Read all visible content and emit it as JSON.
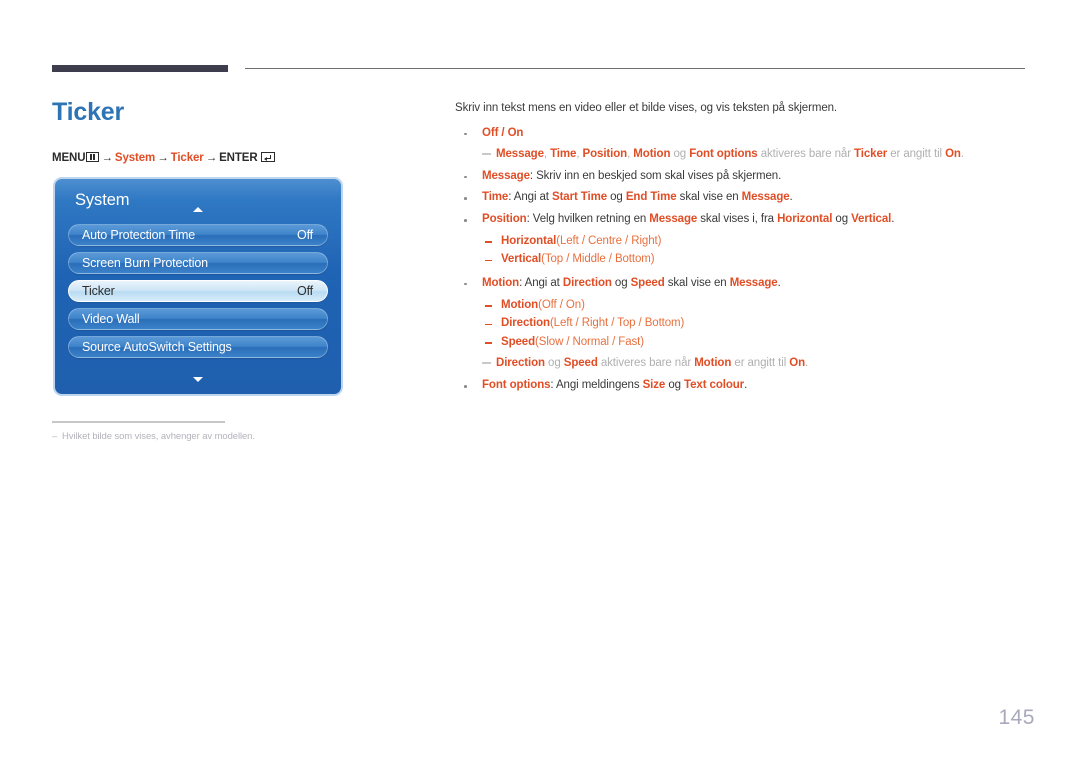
{
  "page": {
    "title": "Ticker",
    "number": "145",
    "title_color": "#2e74b5",
    "accent_color": "#e04e26"
  },
  "breadcrumb": {
    "menu_label": "MENU",
    "menu_icon": "menu-bars-icon",
    "arrow": "→",
    "step1": "System",
    "step2": "Ticker",
    "enter_label": "ENTER",
    "enter_icon": "enter-key-icon"
  },
  "osd": {
    "header": "System",
    "scroll_up_icon": "chevron-up-icon",
    "scroll_down_icon": "chevron-down-icon",
    "rows": [
      {
        "label": "Auto Protection Time",
        "value": "Off",
        "selected": false
      },
      {
        "label": "Screen Burn Protection",
        "value": "",
        "selected": false
      },
      {
        "label": "Ticker",
        "value": "Off",
        "selected": true
      },
      {
        "label": "Video Wall",
        "value": "",
        "selected": false
      },
      {
        "label": "Source AutoSwitch Settings",
        "value": "",
        "selected": false
      }
    ]
  },
  "footnote": {
    "dash": "–",
    "text": "Hvilket bilde som vises, avhenger av modellen."
  },
  "content": {
    "intro": "Skriv inn tekst mens en video eller et bilde vises, og vis teksten på skjermen.",
    "b1_label": "Off / On",
    "note1": {
      "k1": "Message",
      "s1": ", ",
      "k2": "Time",
      "s2": ", ",
      "k3": "Position",
      "s3": ", ",
      "k4": "Motion",
      "s4": " og ",
      "k5": "Font options",
      "s5": " aktiveres bare når ",
      "k6": "Ticker",
      "s6": " er angitt til ",
      "k7": "On",
      "s7": "."
    },
    "b2": {
      "k": "Message",
      "t": ": Skriv inn en beskjed som skal vises på skjermen."
    },
    "b3": {
      "k": "Time",
      "t1": ": Angi at ",
      "k2": "Start Time",
      "t2": " og ",
      "k3": "End Time",
      "t3": " skal vise en ",
      "k4": "Message",
      "t4": "."
    },
    "b4": {
      "k": "Position",
      "t1": ": Velg hvilken retning en ",
      "k2": "Message",
      "t2": " skal vises i, fra ",
      "k3": "Horizontal",
      "t3": " og ",
      "k4": "Vertical",
      "t4": "."
    },
    "sub_horizontal": {
      "k": "Horizontal",
      "v": "(Left / Centre / Right)"
    },
    "sub_vertical": {
      "k": "Vertical",
      "v": "(Top / Middle / Bottom)"
    },
    "b5": {
      "k": "Motion",
      "t1": ": Angi at ",
      "k2": "Direction",
      "t2": " og ",
      "k3": "Speed",
      "t3": " skal vise en ",
      "k4": "Message",
      "t4": "."
    },
    "sub_motion": {
      "k": "Motion",
      "v": "(Off / On)"
    },
    "sub_direction": {
      "k": "Direction",
      "v": "(Left / Right / Top / Bottom)"
    },
    "sub_speed": {
      "k": "Speed",
      "v": "(Slow / Normal / Fast)"
    },
    "note2": {
      "k1": "Direction",
      "s1": " og ",
      "k2": "Speed",
      "s2": " aktiveres bare når ",
      "k3": "Motion",
      "s3": " er angitt til ",
      "k4": "On",
      "s4": "."
    },
    "b6": {
      "k": "Font options",
      "t1": ": Angi meldingens ",
      "k2": "Size",
      "t2": " og ",
      "k3": "Text colour",
      "t3": "."
    }
  }
}
